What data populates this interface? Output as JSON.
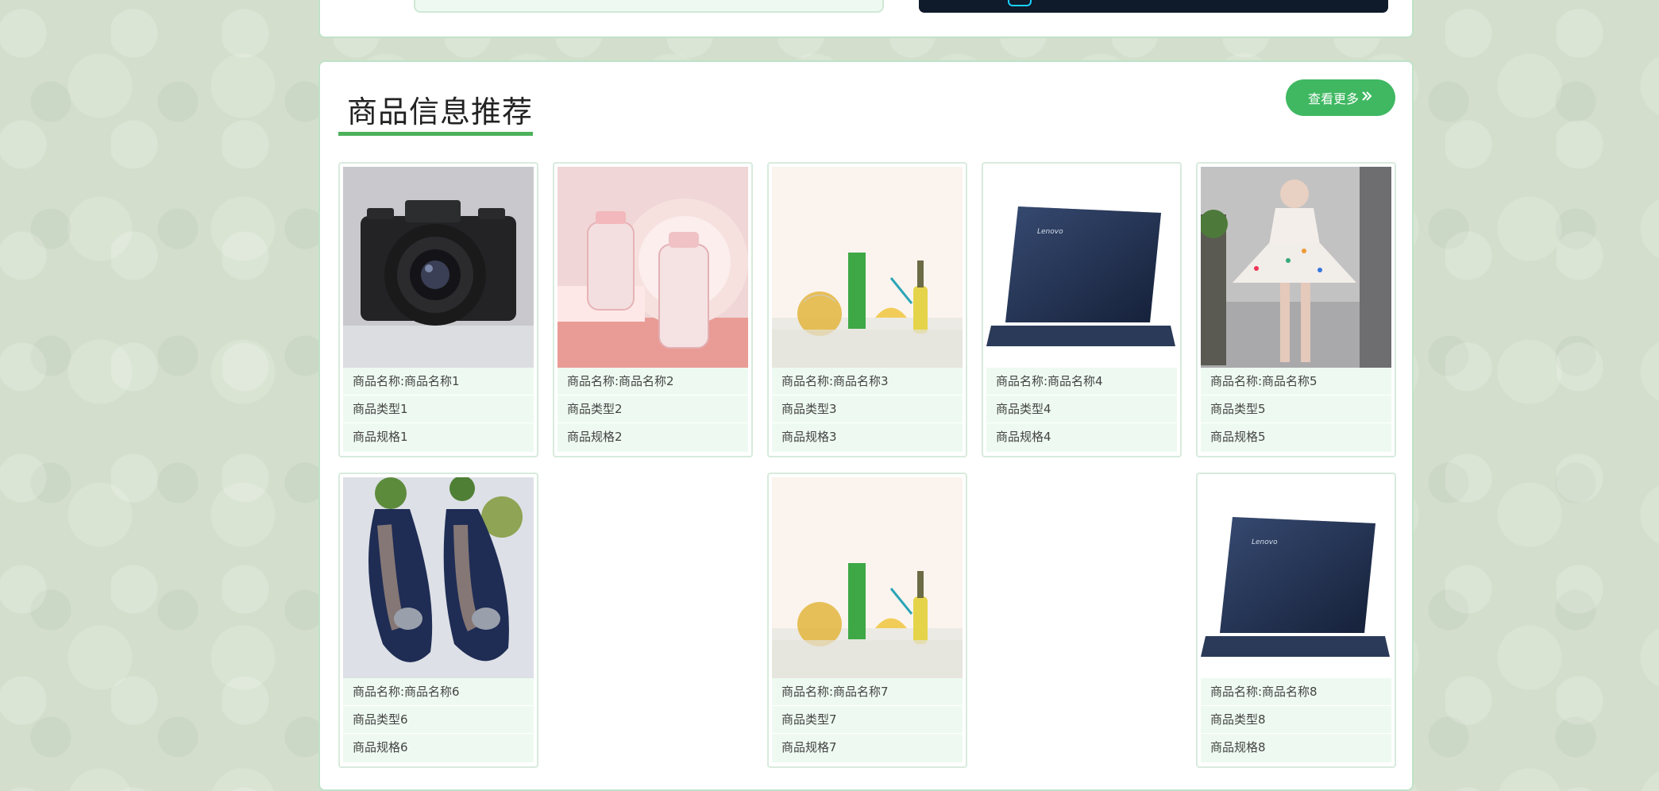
{
  "section": {
    "title": "商品信息推荐",
    "more_label": "查看更多",
    "more_icon": "double-chevron-right-icon"
  },
  "products": [
    {
      "name": "商品名称:商品名称1",
      "type": "商品类型1",
      "spec": "商品规格1",
      "image": "camera"
    },
    {
      "name": "商品名称:商品名称2",
      "type": "商品类型2",
      "spec": "商品规格2",
      "image": "baby-bottles"
    },
    {
      "name": "商品名称:商品名称3",
      "type": "商品类型3",
      "spec": "商品规格3",
      "image": "beverages"
    },
    {
      "name": "商品名称:商品名称4",
      "type": "商品类型4",
      "spec": "商品规格4",
      "image": "laptop",
      "brand": "Lenovo"
    },
    {
      "name": "商品名称:商品名称5",
      "type": "商品类型5",
      "spec": "商品规格5",
      "image": "dress"
    },
    {
      "name": "商品名称:商品名称6",
      "type": "商品类型6",
      "spec": "商品规格6",
      "image": "shoes"
    },
    {
      "name": "商品名称:商品名称7",
      "type": "商品类型7",
      "spec": "商品规格7",
      "image": "beverages"
    },
    {
      "name": "商品名称:商品名称8",
      "type": "商品类型8",
      "spec": "商品规格8",
      "image": "laptop",
      "brand": "Lenovo"
    }
  ],
  "colors": {
    "accent": "#3fb861",
    "underline": "#4cb15a",
    "info_bg": "#eefaf1",
    "border": "#bfe2c8"
  }
}
